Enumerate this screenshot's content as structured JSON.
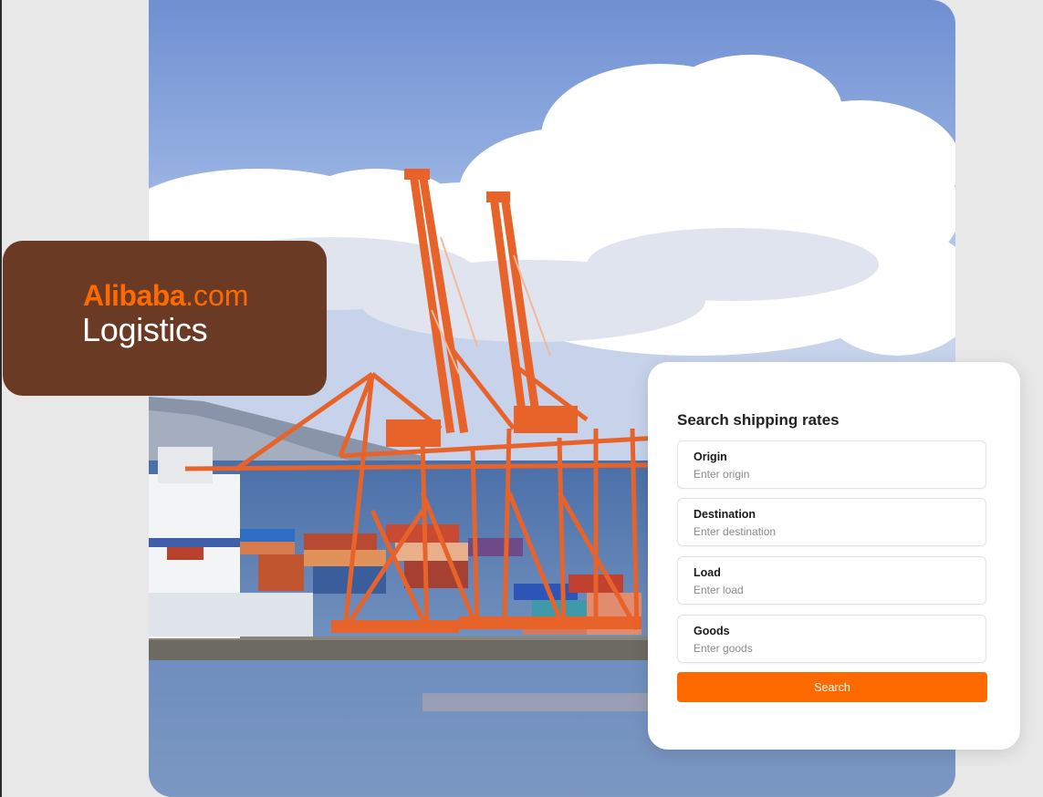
{
  "brand": {
    "name": "Alibaba",
    "tld": ".com",
    "product": "Logistics"
  },
  "colors": {
    "accent": "#ff6a00",
    "logo_card": "#6b3a25"
  },
  "hero_image": {
    "subject": "container-port-cranes"
  },
  "search": {
    "title": "Search shipping rates",
    "fields": [
      {
        "label": "Origin",
        "placeholder": "Enter origin"
      },
      {
        "label": "Destination",
        "placeholder": "Enter destination"
      },
      {
        "label": "Load",
        "placeholder": "Enter load"
      },
      {
        "label": "Goods",
        "placeholder": "Enter goods"
      }
    ],
    "button_label": "Search"
  }
}
